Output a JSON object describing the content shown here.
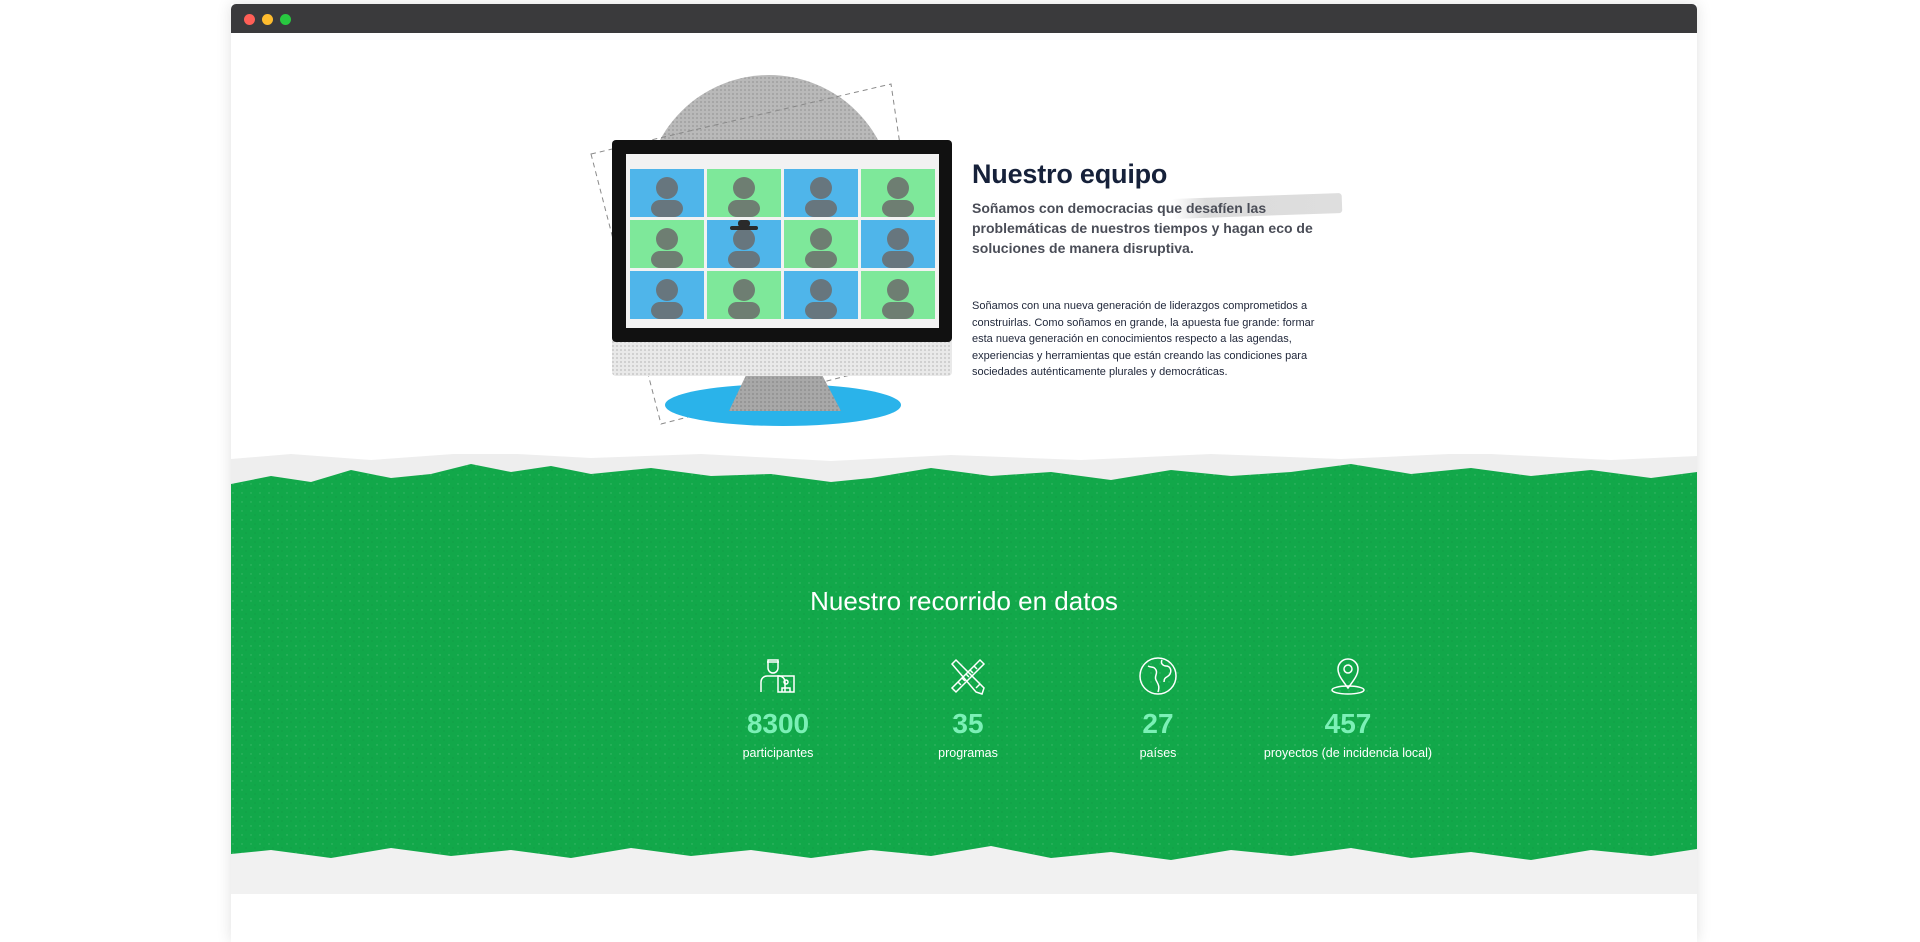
{
  "team": {
    "title": "Nuestro equipo",
    "subtitle": "Soñamos con democracias que desafíen las problemáticas de nuestros tiempos y hagan eco de soluciones de manera disruptiva.",
    "body": "Soñamos con una nueva generación de liderazgos comprometidos a construirlas. Como soñamos en grande, la apuesta fue grande: formar esta nueva generación en conocimientos respecto a las agendas, experiencias y herramientas que están creando las condiciones para sociedades auténticamente plurales y democráticas."
  },
  "stats": {
    "title": "Nuestro recorrido en datos",
    "items": [
      {
        "icon": "participant-icon",
        "value": "8300",
        "label": "participantes"
      },
      {
        "icon": "pencil-ruler-icon",
        "value": "35",
        "label": "programas"
      },
      {
        "icon": "globe-icon",
        "value": "27",
        "label": "países"
      },
      {
        "icon": "location-pin-icon",
        "value": "457",
        "label": "proyectos (de incidencia local)"
      }
    ]
  },
  "colors": {
    "green": "#12a84a",
    "stat_number": "#7bf0b6",
    "title_dark": "#16213a",
    "accent_blue": "#2ab3ea"
  }
}
